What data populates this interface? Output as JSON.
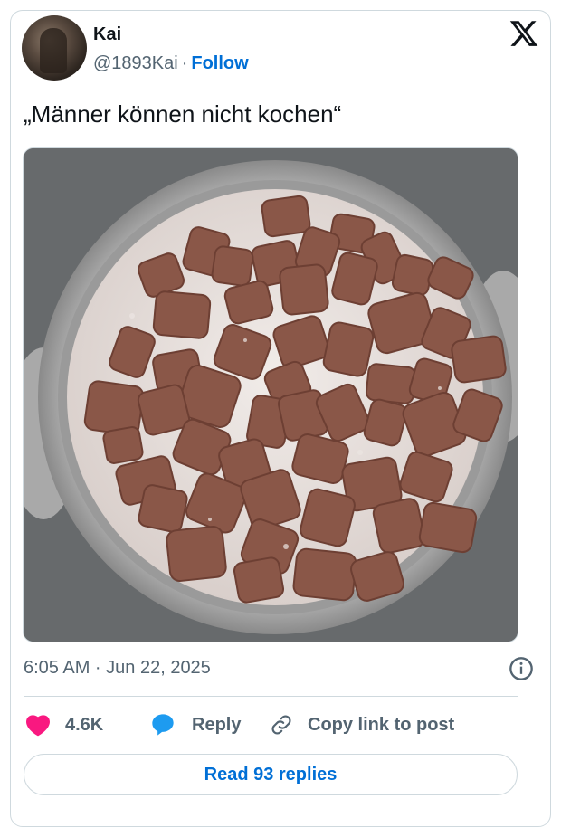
{
  "author": {
    "name": "Kai",
    "handle": "@1893Kai",
    "separator": "·",
    "follow_label": "Follow"
  },
  "tweet": {
    "text": "„Männer können nicht kochen“",
    "timestamp": "6:05 AM · Jun 22, 2025"
  },
  "actions": {
    "likes": "4.6K",
    "reply_label": "Reply",
    "copy_label": "Copy link to post"
  },
  "read_replies_label": "Read 93 replies",
  "colors": {
    "link_blue": "#006fd6",
    "heart_pink": "#f91880",
    "reply_blue": "#1d9bf0",
    "text_gray": "#536471",
    "border": "#cfd9de"
  },
  "icons": {
    "platform": "x-logo-icon",
    "like": "heart-icon",
    "reply": "speech-bubble-icon",
    "copy": "link-icon",
    "info": "info-icon"
  }
}
